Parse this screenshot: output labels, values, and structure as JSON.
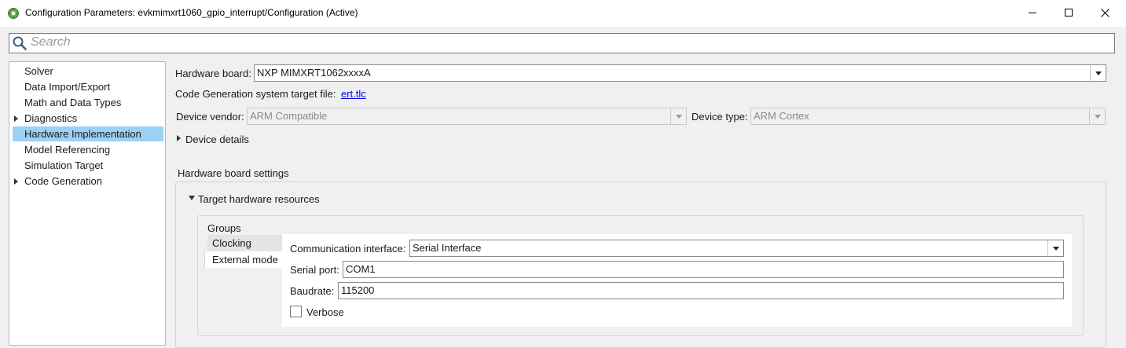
{
  "window": {
    "title": "Configuration Parameters: evkmimxrt1060_gpio_interrupt/Configuration (Active)",
    "app_icon": "matlab-config-icon",
    "controls": [
      "minimize-icon",
      "maximize-icon",
      "close-icon"
    ]
  },
  "search": {
    "placeholder": "Search"
  },
  "tree": {
    "items": [
      {
        "label": "Solver",
        "expandable": false
      },
      {
        "label": "Data Import/Export",
        "expandable": false
      },
      {
        "label": "Math and Data Types",
        "expandable": false
      },
      {
        "label": "Diagnostics",
        "expandable": true
      },
      {
        "label": "Hardware Implementation",
        "expandable": false,
        "selected": true
      },
      {
        "label": "Model Referencing",
        "expandable": false
      },
      {
        "label": "Simulation Target",
        "expandable": false
      },
      {
        "label": "Code Generation",
        "expandable": true
      }
    ]
  },
  "main": {
    "hardware_board_label": "Hardware board:",
    "hardware_board_value": "NXP MIMXRT1062xxxxA",
    "codegen_label": "Code Generation system target file:",
    "codegen_link": "ert.tlc",
    "device_vendor_label": "Device vendor:",
    "device_vendor_value": "ARM Compatible",
    "device_type_label": "Device type:",
    "device_type_value": "ARM Cortex",
    "device_details_label": "Device details",
    "board_settings_title": "Hardware board settings",
    "target_resources_label": "Target hardware resources",
    "groups_label": "Groups",
    "groups": [
      "Clocking",
      "External mode"
    ],
    "selected_group": "External mode",
    "comm_interface_label": "Communication interface:",
    "comm_interface_value": "Serial Interface",
    "serial_port_label": "Serial port:",
    "serial_port_value": "COM1",
    "baudrate_label": "Baudrate:",
    "baudrate_value": "115200",
    "verbose_label": "Verbose",
    "verbose_checked": false
  }
}
